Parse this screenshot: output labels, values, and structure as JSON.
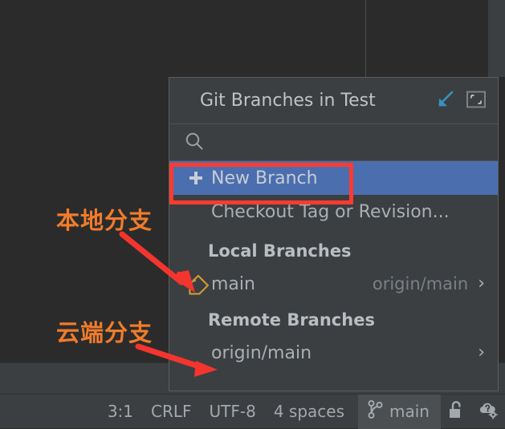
{
  "popup": {
    "title": "Git Branches in Test",
    "header_icons": [
      {
        "name": "checkout-arrow-icon",
        "glyph": "arrow-down-left"
      },
      {
        "name": "restore-window-icon",
        "glyph": "restore-frame"
      }
    ],
    "search": {
      "placeholder": "",
      "value": "",
      "icon": "search-icon"
    },
    "actions": [
      {
        "label": "New Branch",
        "icon": "plus-icon",
        "selected": true
      },
      {
        "label": "Checkout Tag or Revision...",
        "icon": "",
        "selected": false
      }
    ],
    "local_section": {
      "header": "Local Branches",
      "branches": [
        {
          "name": "main",
          "tracking": "origin/main",
          "icon": "tag-icon",
          "chevron": "›"
        }
      ]
    },
    "remote_section": {
      "header": "Remote Branches",
      "branches": [
        {
          "name": "origin/main",
          "icon": "",
          "chevron": "›"
        }
      ]
    }
  },
  "status_bar": {
    "caret_position": "3:1",
    "line_separator": "CRLF",
    "encoding": "UTF-8",
    "indent": "4 spaces",
    "branch": "main",
    "branch_icon": "git-branch-icon",
    "lock_icon": "unlocked-padlock-icon",
    "cloud_icon": "cloud-question-gear-icon"
  },
  "annotations": {
    "local_label": "本地分支",
    "remote_label": "云端分支",
    "highlight_color": "#ff3b30",
    "text_color": "#f07c2b"
  }
}
